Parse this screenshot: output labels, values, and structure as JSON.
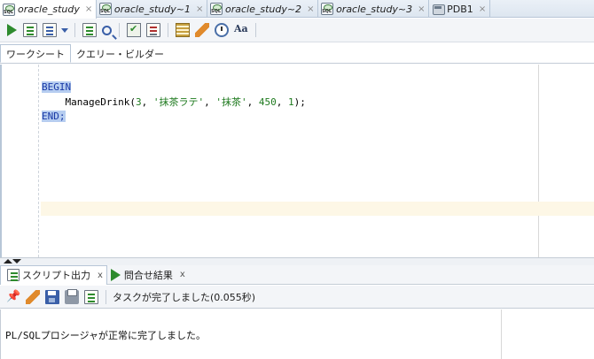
{
  "tabs": [
    {
      "label": "oracle_study",
      "close": "×",
      "active": true
    },
    {
      "label": "oracle_study~1",
      "close": "×",
      "active": false
    },
    {
      "label": "oracle_study~2",
      "close": "×",
      "active": false
    },
    {
      "label": "oracle_study~3",
      "close": "×",
      "active": false
    },
    {
      "label": "PDB1",
      "close": "×",
      "active": false
    }
  ],
  "toolbar": {
    "format_label": "Aa"
  },
  "subtabs": {
    "worksheet": "ワークシート",
    "query_builder": "クエリー・ビルダー"
  },
  "editor": {
    "line1_kw": "BEGIN",
    "line2_indent": "    ",
    "line2_proc": "ManageDrink(",
    "line2_a1": "3",
    "line2_sep1": ", ",
    "line2_a2": "'抹茶ラテ'",
    "line2_sep2": ", ",
    "line2_a3": "'抹茶'",
    "line2_sep3": ", ",
    "line2_a4": "450",
    "line2_sep4": ", ",
    "line2_a5": "1",
    "line2_end": ");",
    "line3_kw": "END;"
  },
  "panel": {
    "tab_output": "スクリプト出力",
    "tab_output_close": "x",
    "tab_results": "問合せ結果",
    "tab_results_close": "x",
    "status": "タスクが完了しました(0.055秒)",
    "output_text": "PL/SQLプロシージャが正常に完了しました。"
  }
}
